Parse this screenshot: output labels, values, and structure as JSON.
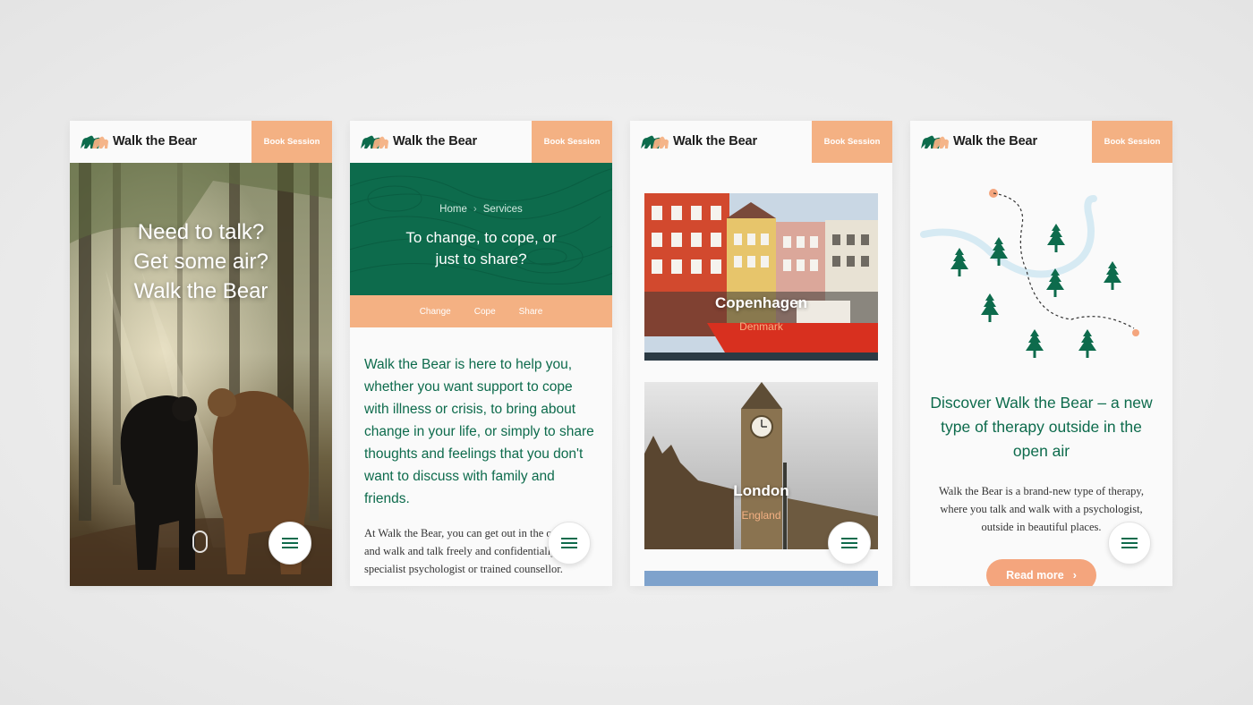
{
  "brand": {
    "name": "Walk the Bear",
    "book_label": "Book Session"
  },
  "colors": {
    "primary_green": "#0d6b4c",
    "accent_peach": "#f4b183"
  },
  "screens": {
    "home": {
      "hero_lines": [
        "Need to talk?",
        "Get some air?",
        "Walk the Bear"
      ]
    },
    "services": {
      "breadcrumb": {
        "home": "Home",
        "current": "Services"
      },
      "title": "To change, to cope, or just to share?",
      "subnav": [
        "Change",
        "Cope",
        "Share"
      ],
      "intro": "Walk the Bear is here to help you, whether you want support to cope with illness or crisis, to bring about change in your life, or simply to share thoughts and feelings that you don't want to discuss with family and friends.",
      "body": "At Walk the Bear, you can get out in the open air and walk and talk freely and confidentially with a specialist psychologist or trained counsellor."
    },
    "locations": {
      "cities": [
        {
          "name": "Copenhagen",
          "country": "Denmark"
        },
        {
          "name": "London",
          "country": "England"
        }
      ]
    },
    "about": {
      "title": "Discover Walk the Bear – a new type of therapy outside in the open air",
      "body": "Walk the Bear is a brand-new type of therapy, where you talk and walk with a psychologist, outside in beautiful places.",
      "cta": "Read more"
    }
  },
  "icons": {
    "logo": "bear-logo-icon",
    "menu": "hamburger-menu-icon",
    "chevron": "chevron-right-icon",
    "tree": "pine-tree-icon",
    "scroll": "scroll-mouse-icon"
  }
}
